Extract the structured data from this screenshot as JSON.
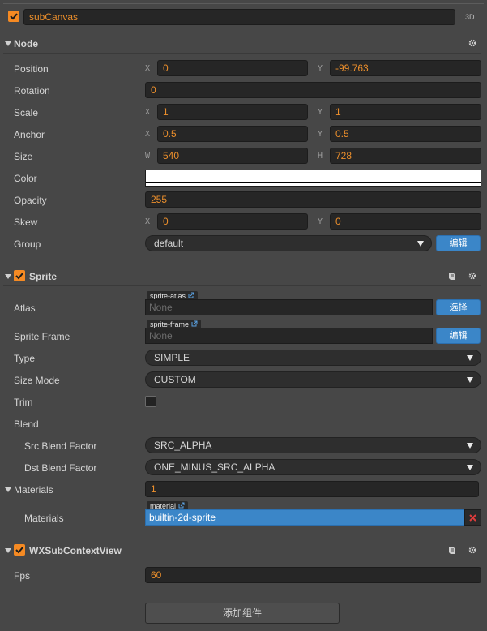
{
  "node_header": {
    "name": "subCanvas",
    "badge_3d": "3D",
    "enabled": true
  },
  "node_section": {
    "title": "Node",
    "position": {
      "label": "Position",
      "x_axis": "X",
      "x": "0",
      "y_axis": "Y",
      "y": "-99.763"
    },
    "rotation": {
      "label": "Rotation",
      "value": "0"
    },
    "scale": {
      "label": "Scale",
      "x_axis": "X",
      "x": "1",
      "y_axis": "Y",
      "y": "1"
    },
    "anchor": {
      "label": "Anchor",
      "x_axis": "X",
      "x": "0.5",
      "y_axis": "Y",
      "y": "0.5"
    },
    "size": {
      "label": "Size",
      "w_axis": "W",
      "w": "540",
      "h_axis": "H",
      "h": "728"
    },
    "color": {
      "label": "Color",
      "value": "#ffffff"
    },
    "opacity": {
      "label": "Opacity",
      "value": "255"
    },
    "skew": {
      "label": "Skew",
      "x_axis": "X",
      "x": "0",
      "y_axis": "Y",
      "y": "0"
    },
    "group": {
      "label": "Group",
      "value": "default",
      "edit_button": "编辑"
    }
  },
  "sprite_section": {
    "title": "Sprite",
    "enabled": true,
    "atlas": {
      "label": "Atlas",
      "tag": "sprite-atlas",
      "value": "None",
      "button": "选择"
    },
    "sprite_frame": {
      "label": "Sprite Frame",
      "tag": "sprite-frame",
      "value": "None",
      "button": "编辑"
    },
    "type": {
      "label": "Type",
      "value": "SIMPLE"
    },
    "size_mode": {
      "label": "Size Mode",
      "value": "CUSTOM"
    },
    "trim": {
      "label": "Trim",
      "checked": false
    },
    "blend": {
      "label": "Blend"
    },
    "src_blend": {
      "label": "Src Blend Factor",
      "value": "SRC_ALPHA"
    },
    "dst_blend": {
      "label": "Dst Blend Factor",
      "value": "ONE_MINUS_SRC_ALPHA"
    },
    "materials_count": {
      "label": "Materials",
      "value": "1"
    },
    "materials": {
      "label": "Materials",
      "tag": "material",
      "value": "builtin-2d-sprite"
    }
  },
  "wx_section": {
    "title": "WXSubContextView",
    "enabled": true,
    "fps": {
      "label": "Fps",
      "value": "60"
    }
  },
  "add_component_button": "添加组件",
  "colors": {
    "accent": "#f58a23",
    "value_text": "#ec8f2c",
    "button_blue": "#3b86c8",
    "panel_bg": "#474747"
  }
}
